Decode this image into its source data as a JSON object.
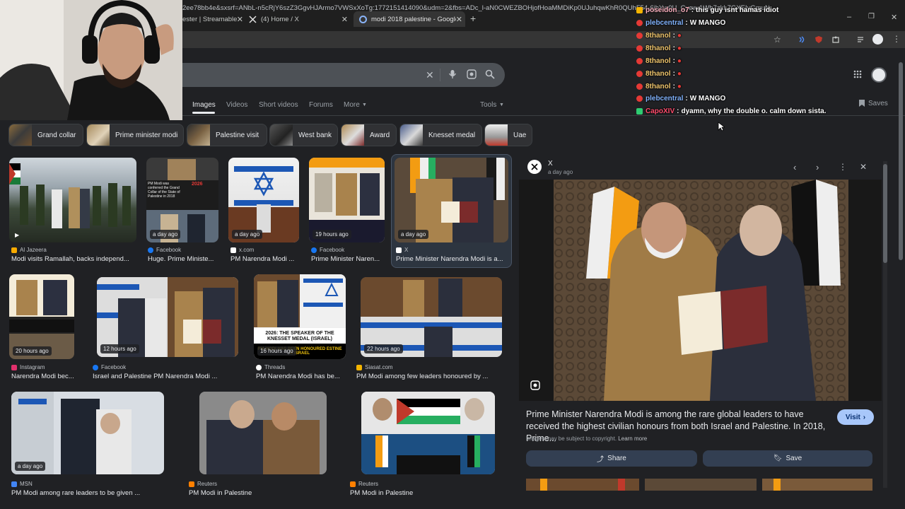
{
  "browser": {
    "tabs": [
      {
        "title": "ester | Streamable",
        "active": false
      },
      {
        "title": "(4) Home / X",
        "active": false
      },
      {
        "title": "modi 2018 palestine - Google S",
        "active": true
      }
    ],
    "url": "2ee78bb4e&sxsrf=ANbL-n5cRjY6szZ3GgvHJArmo7VWSxXoTg:1772151414090&udm=2&fbs=ADc_l-aN0CWEZBOHjofHoaMMDiKp0UJuhqwKhR0QUhF54-6jhYw0U_Cyew 1Wh7zkL7GXEIyGmuNECR0..."
  },
  "google": {
    "nav_tabs": [
      "Images",
      "Videos",
      "Short videos",
      "Forums",
      "More",
      "Tools"
    ],
    "saves_label": "Saves",
    "chips": [
      "Grand collar",
      "Prime minister modi",
      "Palestine visit",
      "West bank",
      "Award",
      "Knesset medal",
      "Uae"
    ]
  },
  "results": [
    {
      "source": "Al Jazeera",
      "caption": "Modi visits Ramallah, backs independ...",
      "badge": "",
      "color": "#f9ab00"
    },
    {
      "source": "Facebook",
      "caption": "Huge. Prime Ministe...",
      "badge": "a day ago",
      "color": "#1877f2"
    },
    {
      "source": "x.com",
      "caption": "PM Narendra Modi ...",
      "badge": "a day ago",
      "color": "#ffffff"
    },
    {
      "source": "Facebook",
      "caption": "Prime Minister Naren...",
      "badge": "19 hours ago",
      "color": "#1877f2"
    },
    {
      "source": "X",
      "caption": "Prime Minister Narendra Modi is a...",
      "badge": "a day ago",
      "color": "#ffffff"
    },
    {
      "source": "Instagram",
      "caption": "Narendra Modi bec...",
      "badge": "20 hours ago",
      "color": "#e1306c"
    },
    {
      "source": "Facebook",
      "caption": "Israel and Palestine PM Narendra Modi ...",
      "badge": "12 hours ago",
      "color": "#1877f2"
    },
    {
      "source": "Threads",
      "caption": "PM Narendra Modi has be...",
      "badge": "16 hours ago",
      "color": "#ffffff"
    },
    {
      "source": "Siasat.com",
      "caption": "PM Modi among few leaders honoured by ...",
      "badge": "22 hours ago",
      "color": "#f4b400"
    },
    {
      "source": "MSN",
      "caption": "PM Modi among rare leaders to be given ...",
      "badge": "a day ago",
      "color": "#4285f4"
    },
    {
      "source": "Reuters",
      "caption": "PM Modi in Palestine",
      "badge": "",
      "color": "#ff8000"
    },
    {
      "source": "Reuters",
      "caption": "PM Modi in Palestine",
      "badge": "",
      "color": "#ff8000"
    }
  ],
  "thumb_texts": {
    "r1_text": "PM Modi was conferred the Grand Collar of the State of Palestine in 2018",
    "r1_year": "2026",
    "r8_headline": "2026: THE SPEAKER OF THE KNESSET MEDAL (ISRAEL)",
    "r8_sub": "PM MODI HAS BEEN HONOURED ESTINE & ISRAEL"
  },
  "preview": {
    "source": "X",
    "time": "a day ago",
    "description": "Prime Minister Narendra Modi is among the rare global leaders to have received the highest civilian honours from both Israel and Palestine. In 2018, Prime...",
    "copyright": "Images may be subject to copyright.",
    "learn_more": "Learn more",
    "visit_label": "Visit",
    "share_label": "Share",
    "save_label": "Save"
  },
  "chat": [
    {
      "user": "poseidon_o7",
      "text": "this guy isnt hamas idiot",
      "color": "#ffb3c1",
      "icon": "#f4b400"
    },
    {
      "user": "plebcentral",
      "text": "W MANGO",
      "color": "#82b4ff",
      "icon": "#e53935"
    },
    {
      "user": "8thanol",
      "text": "",
      "color": "#f0c66e",
      "icon": "#e53935"
    },
    {
      "user": "8thanol",
      "text": "",
      "color": "#f0c66e",
      "icon": "#e53935"
    },
    {
      "user": "8thanol",
      "text": "",
      "color": "#f0c66e",
      "icon": "#e53935"
    },
    {
      "user": "8thanol",
      "text": "",
      "color": "#f0c66e",
      "icon": "#e53935"
    },
    {
      "user": "8thanol",
      "text": "",
      "color": "#f0c66e",
      "icon": "#e53935"
    },
    {
      "user": "plebcentral",
      "text": "W MANGO",
      "color": "#82b4ff",
      "icon": "#e53935"
    },
    {
      "user": "CapoXIV",
      "text": "dyamn, why the double o. calm down sista.",
      "color": "#ff4d6d",
      "icon": "#2ecc71"
    }
  ],
  "colors": {
    "accent": "#8ab4f8",
    "visit_bg": "#a8c7fa",
    "page_bg": "#202124"
  }
}
